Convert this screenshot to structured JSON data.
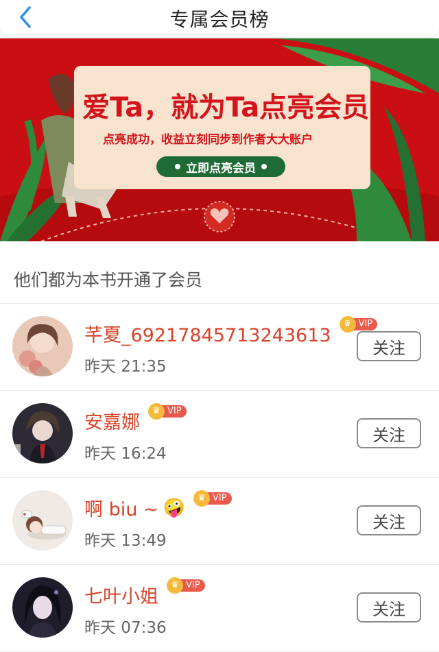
{
  "header": {
    "title": "专属会员榜"
  },
  "banner": {
    "headline": "爱Ta，就为Ta点亮会员",
    "subtitle": "点亮成功，收益立刻同步到作者大大账户",
    "button_label": "立即点亮会员"
  },
  "section": {
    "title": "他们都为本书开通了会员"
  },
  "vip_label": "VIP",
  "follow_label": "关注",
  "members": [
    {
      "name": "芊夏_69217845713243613",
      "emoji": "",
      "time": "昨天 21:35"
    },
    {
      "name": "安嘉娜",
      "emoji": "",
      "time": "昨天 16:24"
    },
    {
      "name": "啊 biu ~",
      "emoji": "🤪",
      "time": "昨天 13:49"
    },
    {
      "name": "七叶小姐",
      "emoji": "",
      "time": "昨天 07:36"
    }
  ],
  "colors": {
    "accent": "#d8442a",
    "banner_red": "#c90f13",
    "banner_green": "#1f6b36",
    "back_arrow": "#2a8ff0"
  }
}
